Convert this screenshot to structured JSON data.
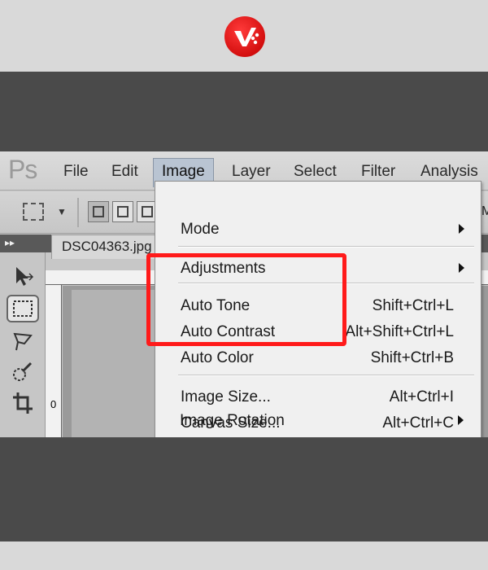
{
  "menubar": {
    "app_logo": "Ps",
    "items": [
      "File",
      "Edit",
      "Image",
      "Layer",
      "Select",
      "Filter",
      "Analysis"
    ],
    "active": "Image"
  },
  "document_tab": "DSC04363.jpg",
  "options_right": "M",
  "ruler_zero": "0",
  "image_menu": {
    "items": [
      {
        "label": "Mode",
        "submenu": true
      },
      {
        "label": "Adjustments",
        "submenu": true
      },
      {
        "label": "Auto Tone",
        "shortcut": "Shift+Ctrl+L"
      },
      {
        "label": "Auto Contrast",
        "shortcut": "Alt+Shift+Ctrl+L"
      },
      {
        "label": "Auto Color",
        "shortcut": "Shift+Ctrl+B"
      },
      {
        "label": "Image Size...",
        "shortcut": "Alt+Ctrl+I"
      },
      {
        "label": "Canvas Size...",
        "shortcut": "Alt+Ctrl+C"
      },
      {
        "label": "Image Rotation",
        "submenu": true
      }
    ]
  },
  "icons": {
    "logo": "brand-logo-icon",
    "tools": [
      "move-tool-icon",
      "marquee-tool-icon",
      "lasso-tool-icon",
      "quick-selection-tool-icon",
      "crop-tool-icon"
    ]
  },
  "colors": {
    "highlight": "#ff1a1a",
    "logo_red": "#d40f0f",
    "frame_dark": "#4a4a4a",
    "frame_light": "#d9d9d9"
  }
}
